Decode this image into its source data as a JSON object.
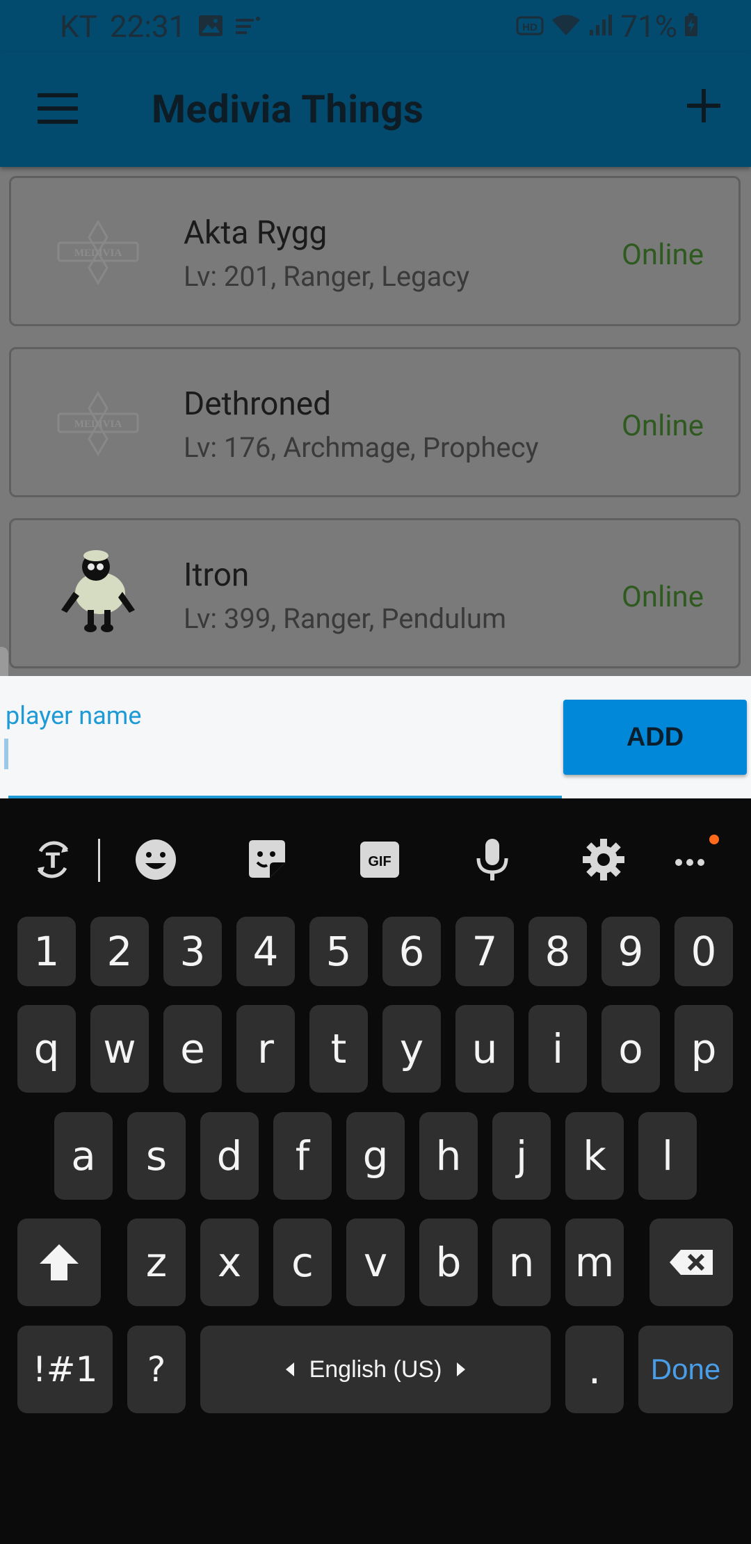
{
  "status_bar": {
    "carrier": "KT",
    "time": "22:31",
    "battery": "71%"
  },
  "app_bar": {
    "title": "Medivia Things"
  },
  "players": [
    {
      "name": "Akta Rygg",
      "info": "Lv: 201, Ranger, Legacy",
      "status": "Online",
      "avatar": "medivia-logo"
    },
    {
      "name": "Dethroned",
      "info": "Lv: 176, Archmage, Prophecy",
      "status": "Online",
      "avatar": "medivia-logo"
    },
    {
      "name": "Itron",
      "info": "Lv: 399, Ranger, Pendulum",
      "status": "Online",
      "avatar": "sheep"
    }
  ],
  "input": {
    "label": "player name",
    "value": ""
  },
  "add_button": {
    "label": "ADD"
  },
  "keyboard": {
    "number_row": [
      "1",
      "2",
      "3",
      "4",
      "5",
      "6",
      "7",
      "8",
      "9",
      "0"
    ],
    "row1": [
      "q",
      "w",
      "e",
      "r",
      "t",
      "y",
      "u",
      "i",
      "o",
      "p"
    ],
    "row2": [
      "a",
      "s",
      "d",
      "f",
      "g",
      "h",
      "j",
      "k",
      "l"
    ],
    "row3": [
      "z",
      "x",
      "c",
      "v",
      "b",
      "n",
      "m"
    ],
    "symbols_key": "!#1",
    "question_key": "?",
    "space_label": "English (US)",
    "period_key": ".",
    "done_key": "Done"
  },
  "colors": {
    "app_bar": "#034b6e",
    "online": "#2e5a1f",
    "accent": "#0288d9",
    "keyboard_bg": "#0b0b0b",
    "key_bg": "#2f2f2f",
    "done": "#4a9ee8"
  }
}
